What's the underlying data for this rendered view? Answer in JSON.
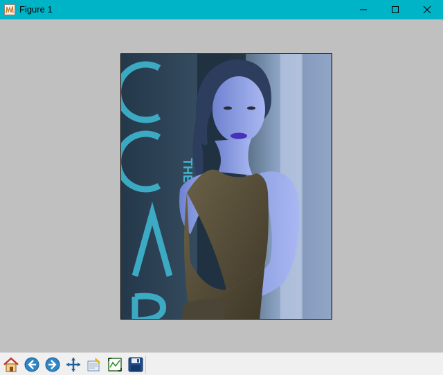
{
  "window": {
    "title": "Figure 1"
  },
  "icons": {
    "app": "matplotlib-figure-icon",
    "minimize": "minimize-icon",
    "maximize": "maximize-icon",
    "close": "close-icon"
  },
  "toolbar": {
    "buttons": [
      {
        "name": "home",
        "icon": "home-icon"
      },
      {
        "name": "back",
        "icon": "back-arrow-icon"
      },
      {
        "name": "forward",
        "icon": "forward-arrow-icon"
      },
      {
        "name": "pan",
        "icon": "pan-move-icon"
      },
      {
        "name": "zoom",
        "icon": "zoom-rect-icon"
      },
      {
        "name": "subplots",
        "icon": "subplots-config-icon"
      },
      {
        "name": "save",
        "icon": "save-disk-icon"
      }
    ]
  },
  "colors": {
    "titlebar": "#00b4c8",
    "figure_background": "#c0c0c0",
    "toolbar_background": "#f0f0f0"
  }
}
